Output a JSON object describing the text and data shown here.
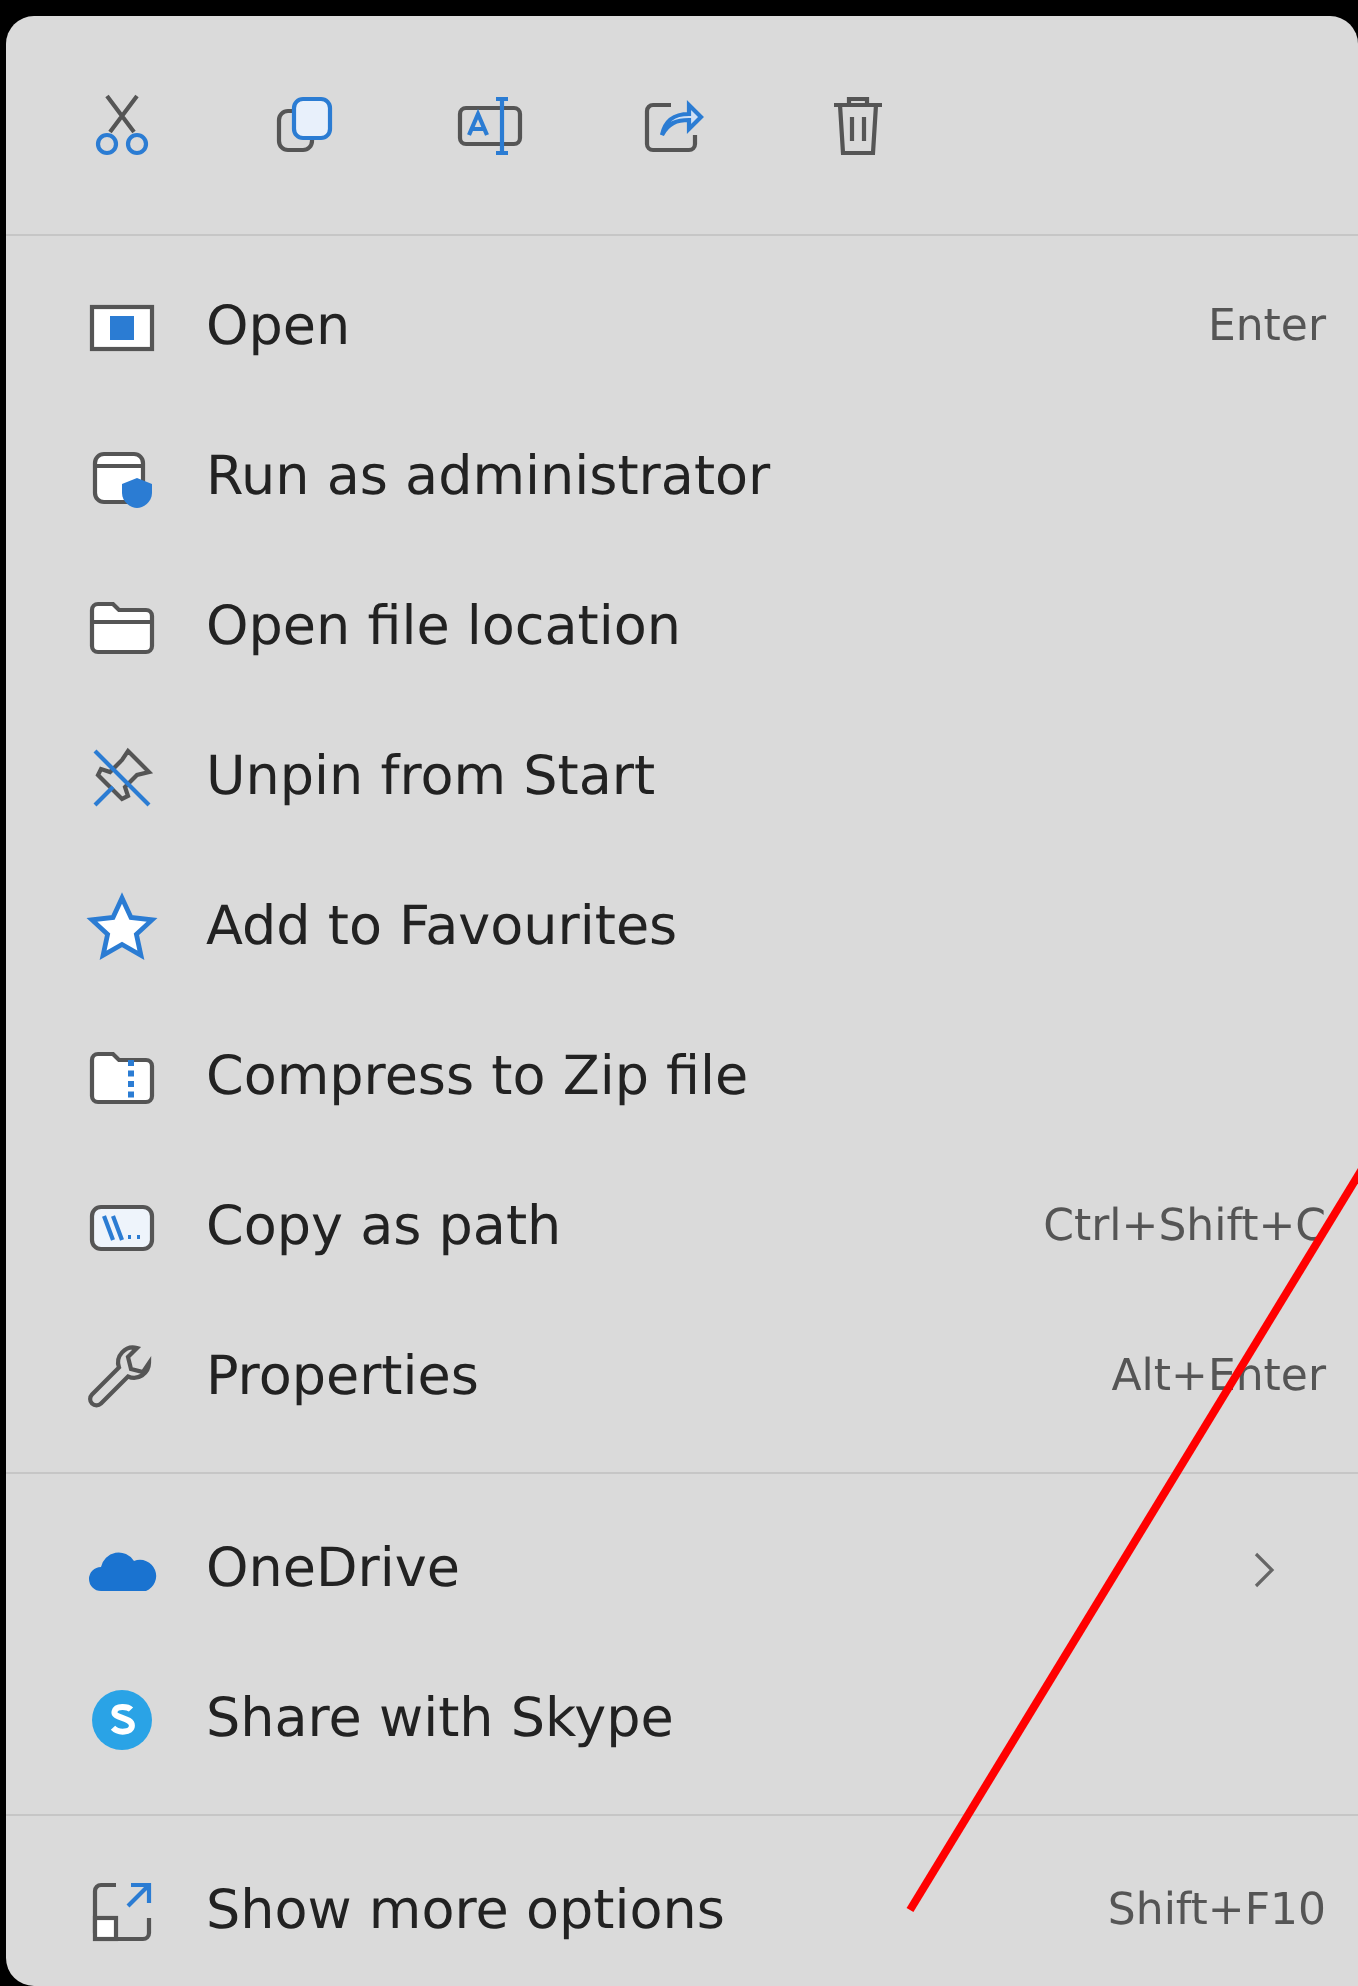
{
  "toolbar": [
    {
      "kind": "cut"
    },
    {
      "kind": "copy"
    },
    {
      "kind": "rename"
    },
    {
      "kind": "share"
    },
    {
      "kind": "delete"
    }
  ],
  "groups": [
    {
      "items": [
        {
          "kind": "open",
          "label": "Open",
          "shortcut": "Enter",
          "submenu": false
        },
        {
          "kind": "admin",
          "label": "Run as administrator",
          "submenu": false
        },
        {
          "kind": "folder",
          "label": "Open file location",
          "submenu": false
        },
        {
          "kind": "unpin",
          "label": "Unpin from Start",
          "submenu": false
        },
        {
          "kind": "star",
          "label": "Add to Favourites",
          "submenu": false
        },
        {
          "kind": "zip",
          "label": "Compress to Zip file",
          "submenu": false
        },
        {
          "kind": "path",
          "label": "Copy as path",
          "shortcut": "Ctrl+Shift+C",
          "submenu": false
        },
        {
          "kind": "wrench",
          "label": "Properties",
          "shortcut": "Alt+Enter",
          "submenu": false
        }
      ]
    },
    {
      "items": [
        {
          "kind": "cloud",
          "label": "OneDrive",
          "submenu": true
        },
        {
          "kind": "skype",
          "label": "Share with Skype",
          "submenu": false
        }
      ]
    },
    {
      "items": [
        {
          "kind": "more",
          "label": "Show more options",
          "shortcut": "Shift+F10",
          "submenu": false
        }
      ]
    }
  ]
}
